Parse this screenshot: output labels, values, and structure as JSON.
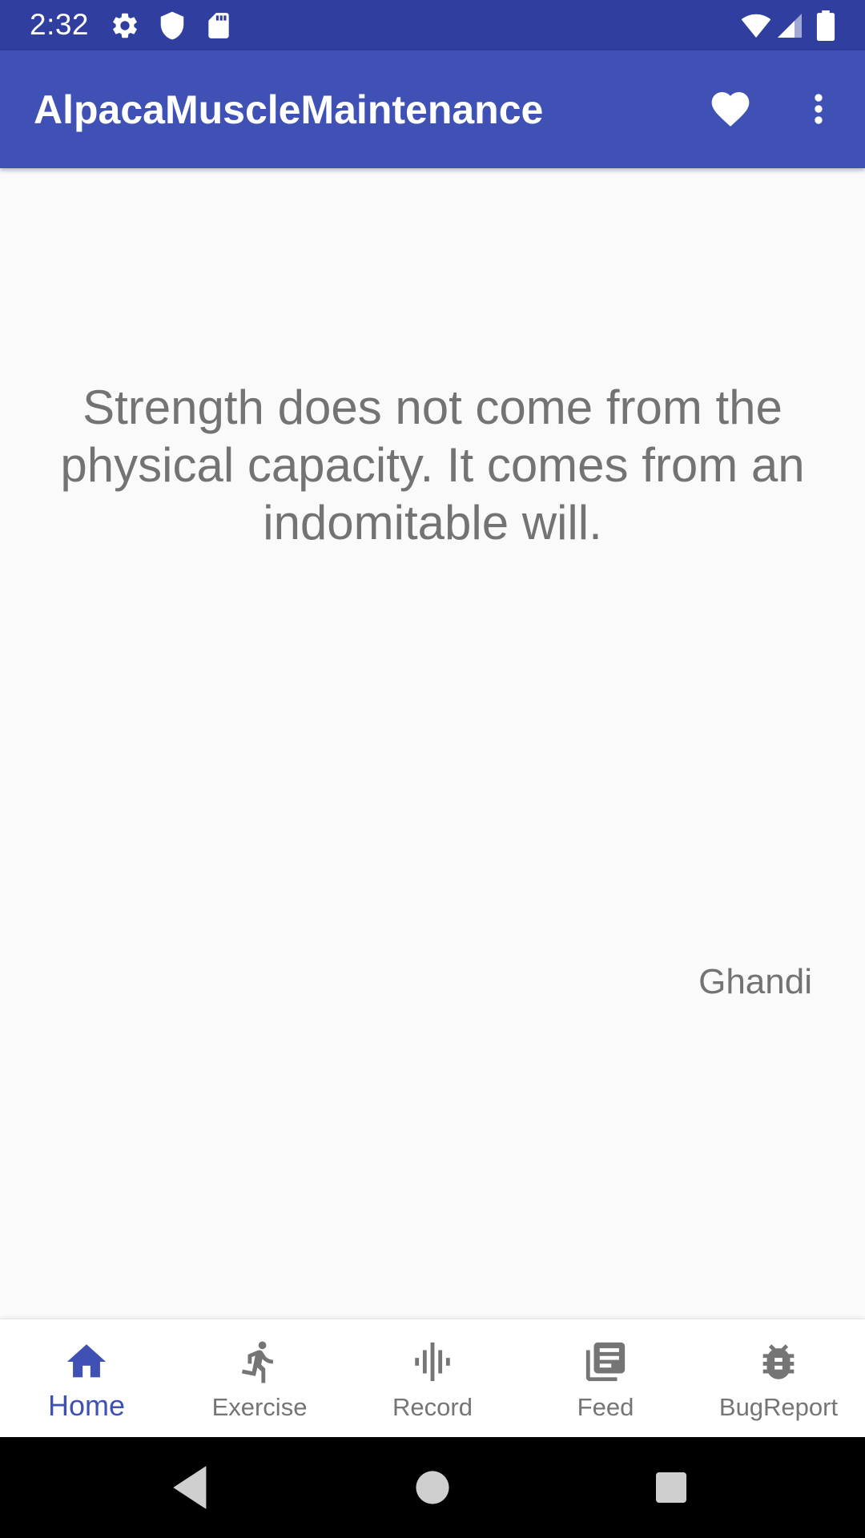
{
  "status_bar": {
    "time": "2:32",
    "left_icons": [
      "gear-icon",
      "shield-icon",
      "sd-card-icon"
    ],
    "right_icons": [
      "wifi-icon",
      "signal-icon",
      "battery-icon"
    ]
  },
  "app_bar": {
    "title": "AlpacaMuscleMaintenance",
    "actions": [
      "heart-icon",
      "more-vert-icon"
    ]
  },
  "main": {
    "quote": "Strength does not come from the physical capacity. It comes from an indomitable will.",
    "author": "Ghandi"
  },
  "bottom_nav": {
    "active_index": 0,
    "items": [
      {
        "label": "Home",
        "icon": "home-icon"
      },
      {
        "label": "Exercise",
        "icon": "running-icon"
      },
      {
        "label": "Record",
        "icon": "audio-wave-icon"
      },
      {
        "label": "Feed",
        "icon": "library-books-icon"
      },
      {
        "label": "BugReport",
        "icon": "bug-icon"
      }
    ]
  },
  "system_nav": [
    "back-icon",
    "home-circle-icon",
    "recents-icon"
  ],
  "colors": {
    "status_bar": "#303f9f",
    "primary": "#3f51b5",
    "text_secondary": "#737373",
    "nav_inactive": "#757575",
    "background": "#fafafa"
  }
}
